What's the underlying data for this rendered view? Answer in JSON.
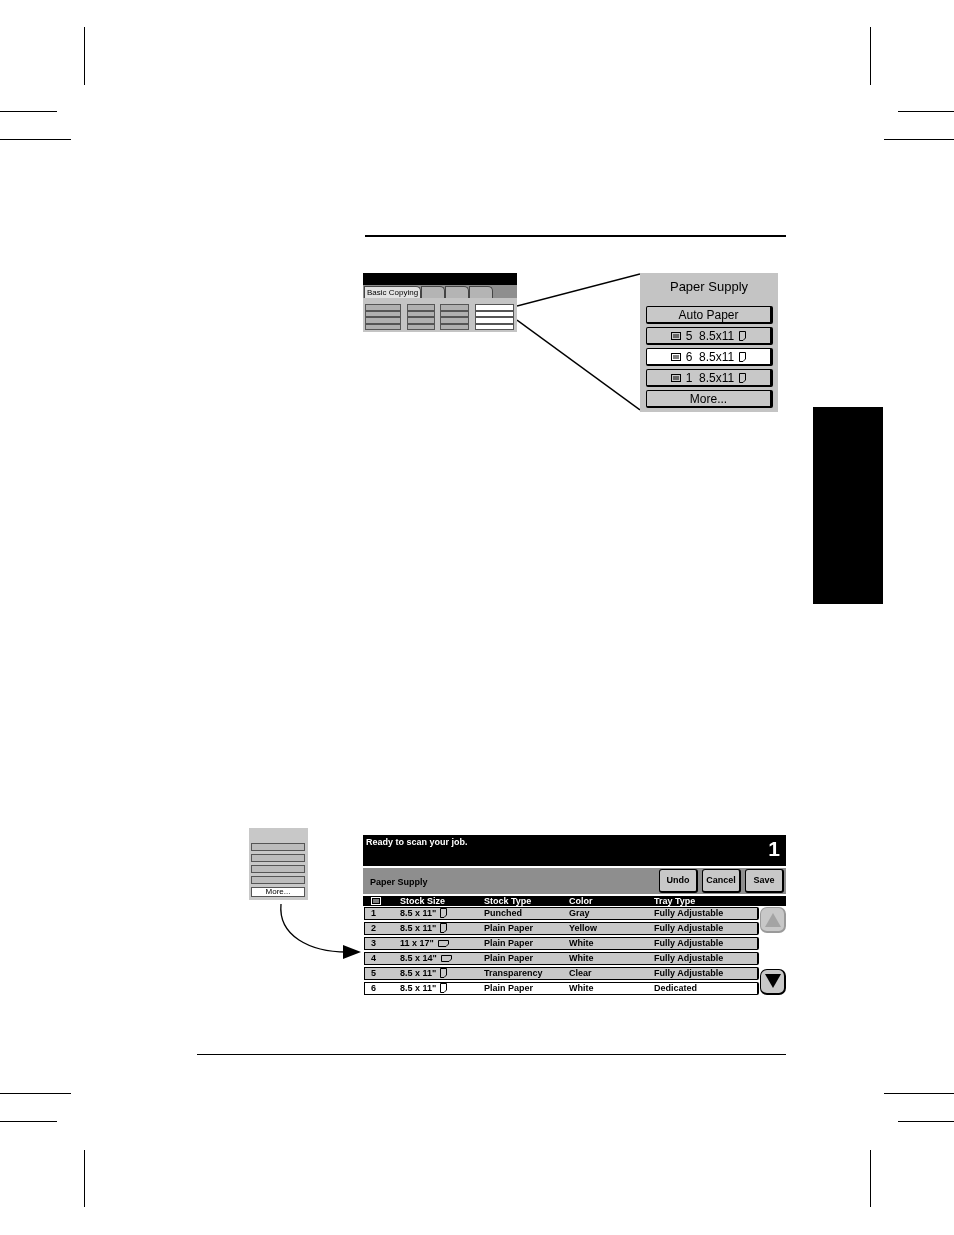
{
  "overview_thumbnail": {
    "tabs": [
      {
        "label": "Basic Copying",
        "selected": true
      },
      {
        "selected": false
      },
      {
        "selected": false
      },
      {
        "selected": false
      }
    ],
    "columns": [
      {
        "selected": false
      },
      {
        "selected": false
      },
      {
        "selected": false
      },
      {
        "selected": true
      }
    ]
  },
  "paper_supply_panel": {
    "title": "Paper Supply",
    "buttons": [
      {
        "kind": "text",
        "label": "Auto Paper",
        "selected": false
      },
      {
        "kind": "tray",
        "tray": "5",
        "size": "8.5x11",
        "landscape": false,
        "selected": false
      },
      {
        "kind": "tray",
        "tray": "6",
        "size": "8.5x11",
        "landscape": false,
        "selected": true
      },
      {
        "kind": "tray",
        "tray": "1",
        "size": "8.5x11",
        "landscape": false,
        "selected": false
      },
      {
        "kind": "text",
        "label": "More...",
        "selected": false
      }
    ]
  },
  "panel_thumbnail": {
    "buttons": [
      {
        "selected": false
      },
      {
        "selected": false
      },
      {
        "selected": false
      },
      {
        "selected": false
      },
      {
        "label": "More...",
        "selected": true
      }
    ]
  },
  "paper_supply_screen": {
    "status_message": "Ready to scan your job.",
    "copy_count": "1",
    "title": "Paper Supply",
    "actions": [
      {
        "label": "Undo"
      },
      {
        "label": "Cancel"
      },
      {
        "label": "Save"
      }
    ],
    "table": {
      "columns": [
        "Stock Size",
        "Stock Type",
        "Color",
        "Tray Type"
      ],
      "rows": [
        {
          "tray": "1",
          "stock_size": "8.5 x 11\"",
          "landscape": false,
          "stock_type": "Punched",
          "paper_color": "Gray",
          "tray_type": "Fully Adjustable",
          "selected": false
        },
        {
          "tray": "2",
          "stock_size": "8.5 x 11\"",
          "landscape": false,
          "stock_type": "Plain Paper",
          "paper_color": "Yellow",
          "tray_type": "Fully Adjustable",
          "selected": false
        },
        {
          "tray": "3",
          "stock_size": "11 x 17\"",
          "landscape": true,
          "stock_type": "Plain Paper",
          "paper_color": "White",
          "tray_type": "Fully Adjustable",
          "selected": false
        },
        {
          "tray": "4",
          "stock_size": "8.5 x 14\"",
          "landscape": true,
          "stock_type": "Plain Paper",
          "paper_color": "White",
          "tray_type": "Fully Adjustable",
          "selected": false
        },
        {
          "tray": "5",
          "stock_size": "8.5 x 11\"",
          "landscape": false,
          "stock_type": "Transparency",
          "paper_color": "Clear",
          "tray_type": "Fully Adjustable",
          "selected": false
        },
        {
          "tray": "6",
          "stock_size": "8.5 x 11\"",
          "landscape": false,
          "stock_type": "Plain Paper",
          "paper_color": "White",
          "tray_type": "Dedicated",
          "selected": true
        }
      ]
    },
    "scroll_up": {
      "disabled": true
    },
    "scroll_down": {
      "disabled": false
    }
  }
}
